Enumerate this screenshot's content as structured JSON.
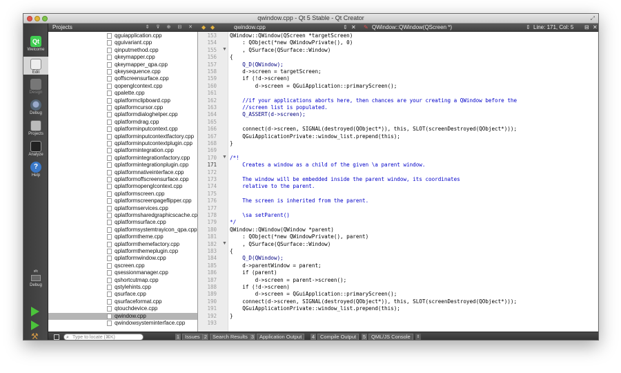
{
  "window": {
    "title": "qwindow.cpp - Qt 5 Stable - Qt Creator"
  },
  "modes": [
    {
      "label": "Welcome",
      "icon": "qt-logo-icon"
    },
    {
      "label": "Edit",
      "icon": "edit-icon"
    },
    {
      "label": "Design",
      "icon": "design-icon"
    },
    {
      "label": "Debug",
      "icon": "debug-icon"
    },
    {
      "label": "Projects",
      "icon": "projects-icon"
    },
    {
      "label": "Analyze",
      "icon": "analyze-icon"
    },
    {
      "label": "Help",
      "icon": "help-icon"
    }
  ],
  "target": {
    "project": "sfc",
    "mode": "Debug"
  },
  "projects": {
    "title": "Projects",
    "files": [
      "qguiapplication.cpp",
      "qguivariant.cpp",
      "qinputmethod.cpp",
      "qkeymapper.cpp",
      "qkeymapper_qpa.cpp",
      "qkeysequence.cpp",
      "qoffscreensurface.cpp",
      "qopenglcontext.cpp",
      "qpalette.cpp",
      "qplatformclipboard.cpp",
      "qplatformcursor.cpp",
      "qplatformdialoghelper.cpp",
      "qplatformdrag.cpp",
      "qplatforminputcontext.cpp",
      "qplatforminputcontextfactory.cpp",
      "qplatforminputcontextplugin.cpp",
      "qplatformintegration.cpp",
      "qplatformintegrationfactory.cpp",
      "qplatformintegrationplugin.cpp",
      "qplatformnativeinterface.cpp",
      "qplatformoffscreensurface.cpp",
      "qplatformopenglcontext.cpp",
      "qplatformscreen.cpp",
      "qplatformscreenpageflipper.cpp",
      "qplatformservices.cpp",
      "qplatformsharedgraphicscache.cpp",
      "qplatformsurface.cpp",
      "qplatformsystemtrayicon_qpa.cpp",
      "qplatformtheme.cpp",
      "qplatformthemefactory.cpp",
      "qplatformthemeplugin.cpp",
      "qplatformwindow.cpp",
      "qscreen.cpp",
      "qsessionmanager.cpp",
      "qshortcutmap.cpp",
      "qstylehints.cpp",
      "qsurface.cpp",
      "qsurfaceformat.cpp",
      "qtouchdevice.cpp",
      "qwindow.cpp",
      "qwindowsysteminterface.cpp"
    ],
    "selected_index": 39
  },
  "editor": {
    "file": "qwindow.cpp",
    "symbol": "QWindow::QWindow(QScreen *)",
    "position": "Line: 171, Col: 5",
    "current_line": "171",
    "lines": [
      {
        "n": "153",
        "text": "QWindow::QWindow(QScreen *targetScreen)",
        "fold": ""
      },
      {
        "n": "154",
        "text": "    : QObject(*new QWindowPrivate(), 0)",
        "fold": ""
      },
      {
        "n": "155",
        "text": "    , QSurface(QSurface::Window)",
        "fold": "▼"
      },
      {
        "n": "156",
        "text": "{",
        "fold": ""
      },
      {
        "n": "157",
        "text": "    Q_D(QWindow);",
        "fold": ""
      },
      {
        "n": "158",
        "text": "    d->screen = targetScreen;",
        "fold": ""
      },
      {
        "n": "159",
        "text": "    if (!d->screen)",
        "fold": ""
      },
      {
        "n": "160",
        "text": "        d->screen = QGuiApplication::primaryScreen();",
        "fold": ""
      },
      {
        "n": "161",
        "text": "",
        "fold": ""
      },
      {
        "n": "162",
        "text": "    //if your applications aborts here, then chances are your creating a QWindow before the",
        "fold": ""
      },
      {
        "n": "163",
        "text": "    //screen list is populated.",
        "fold": ""
      },
      {
        "n": "164",
        "text": "    Q_ASSERT(d->screen);",
        "fold": ""
      },
      {
        "n": "165",
        "text": "",
        "fold": ""
      },
      {
        "n": "166",
        "text": "    connect(d->screen, SIGNAL(destroyed(QObject*)), this, SLOT(screenDestroyed(QObject*)));",
        "fold": ""
      },
      {
        "n": "167",
        "text": "    QGuiApplicationPrivate::window_list.prepend(this);",
        "fold": ""
      },
      {
        "n": "168",
        "text": "}",
        "fold": ""
      },
      {
        "n": "169",
        "text": "",
        "fold": ""
      },
      {
        "n": "170",
        "text": "/*!",
        "fold": "▼"
      },
      {
        "n": "171",
        "text": "    Creates a window as a child of the given \\a parent window.",
        "fold": ""
      },
      {
        "n": "172",
        "text": "",
        "fold": ""
      },
      {
        "n": "173",
        "text": "    The window will be embedded inside the parent window, its coordinates",
        "fold": ""
      },
      {
        "n": "174",
        "text": "    relative to the parent.",
        "fold": ""
      },
      {
        "n": "175",
        "text": "",
        "fold": ""
      },
      {
        "n": "176",
        "text": "    The screen is inherited from the parent.",
        "fold": ""
      },
      {
        "n": "177",
        "text": "",
        "fold": ""
      },
      {
        "n": "178",
        "text": "    \\sa setParent()",
        "fold": ""
      },
      {
        "n": "179",
        "text": "*/",
        "fold": ""
      },
      {
        "n": "180",
        "text": "QWindow::QWindow(QWindow *parent)",
        "fold": ""
      },
      {
        "n": "181",
        "text": "    : QObject(*new QWindowPrivate(), parent)",
        "fold": ""
      },
      {
        "n": "182",
        "text": "    , QSurface(QSurface::Window)",
        "fold": "▼"
      },
      {
        "n": "183",
        "text": "{",
        "fold": ""
      },
      {
        "n": "184",
        "text": "    Q_D(QWindow);",
        "fold": ""
      },
      {
        "n": "185",
        "text": "    d->parentWindow = parent;",
        "fold": ""
      },
      {
        "n": "186",
        "text": "    if (parent)",
        "fold": ""
      },
      {
        "n": "187",
        "text": "        d->screen = parent->screen();",
        "fold": ""
      },
      {
        "n": "188",
        "text": "    if (!d->screen)",
        "fold": ""
      },
      {
        "n": "189",
        "text": "        d->screen = QGuiApplication::primaryScreen();",
        "fold": ""
      },
      {
        "n": "190",
        "text": "    connect(d->screen, SIGNAL(destroyed(QObject*)), this, SLOT(screenDestroyed(QObject*)));",
        "fold": ""
      },
      {
        "n": "191",
        "text": "    QGuiApplicationPrivate::window_list.prepend(this);",
        "fold": ""
      },
      {
        "n": "192",
        "text": "}",
        "fold": ""
      },
      {
        "n": "193",
        "text": "",
        "fold": ""
      }
    ]
  },
  "statusbar": {
    "locate_placeholder": "Type to locate (⌘K)",
    "tabs": [
      {
        "num": "1",
        "label": "Issues"
      },
      {
        "num": "2",
        "label": "Search Results"
      },
      {
        "num": "3",
        "label": "Application Output"
      },
      {
        "num": "4",
        "label": "Compile Output"
      },
      {
        "num": "5",
        "label": "QML/JS Console"
      }
    ]
  },
  "colors": {
    "comment": "#0000c8",
    "keyword": "#808000",
    "macro": "#000080",
    "selection": "#b5b5b5"
  }
}
